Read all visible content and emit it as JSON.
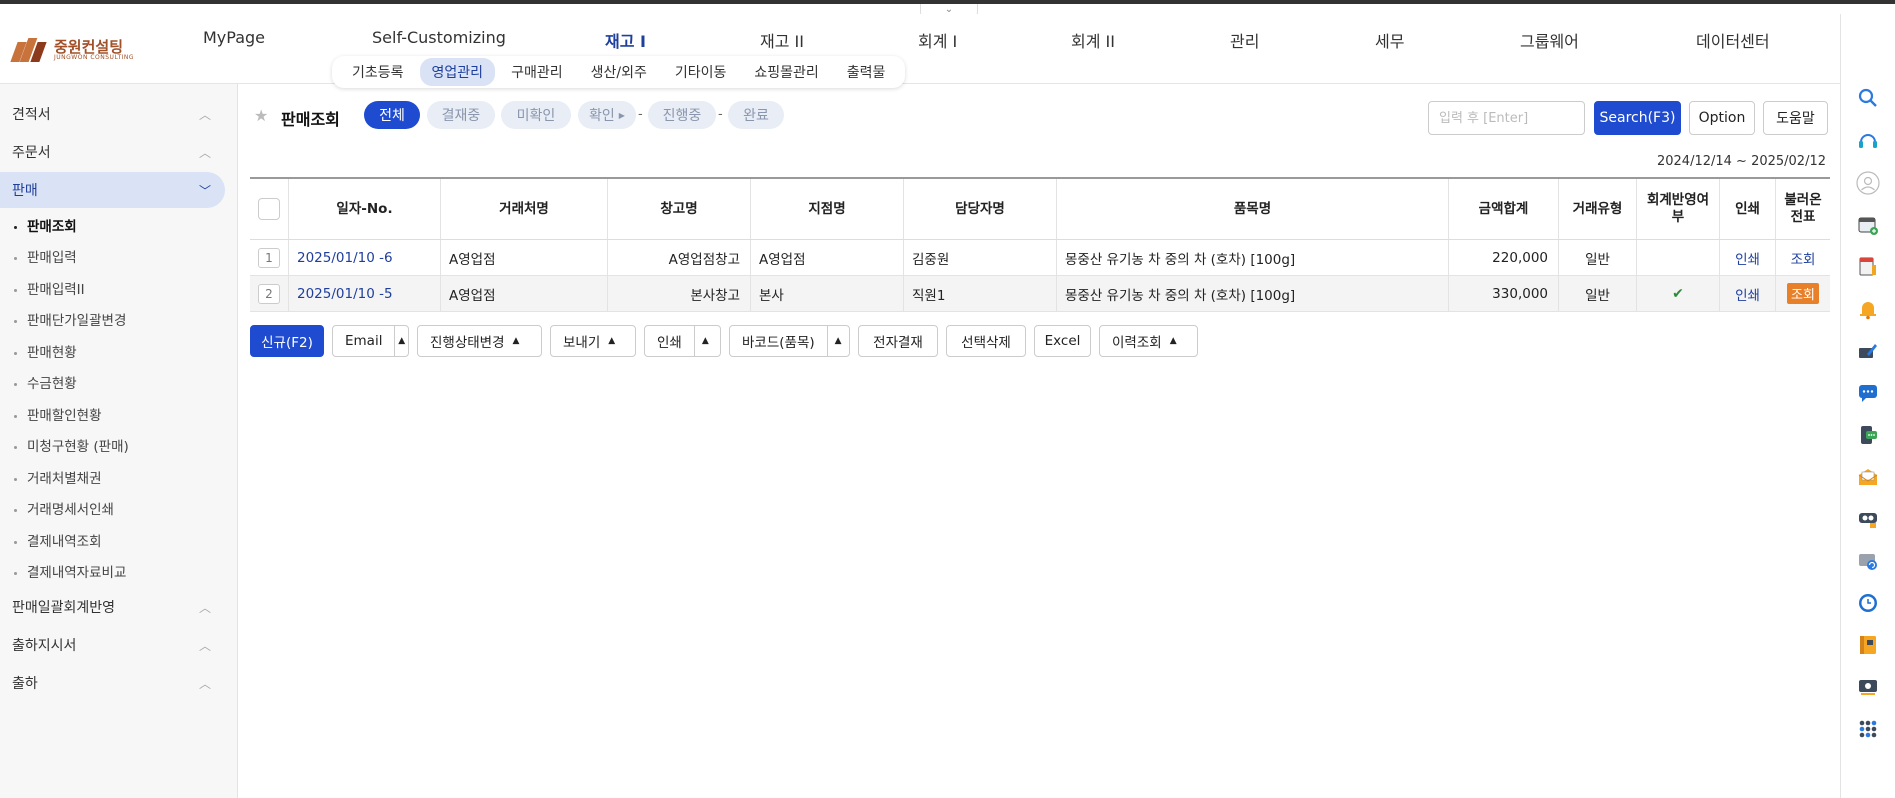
{
  "logo": {
    "ko": "중원컨설팅",
    "en": "JUNGWON CONSULTING"
  },
  "mainnav": [
    "MyPage",
    "Self-Customizing",
    "재고 I",
    "재고 II",
    "회계 I",
    "회계 II",
    "관리",
    "세무",
    "그룹웨어",
    "데이터센터"
  ],
  "mainnav_active": "재고 I",
  "subnav": [
    "기초등록",
    "영업관리",
    "구매관리",
    "생산/외주",
    "기타이동",
    "쇼핑몰관리",
    "출력물"
  ],
  "subnav_active": "영업관리",
  "sidebar": {
    "groups": [
      {
        "label": "견적서",
        "state": "collapsed"
      },
      {
        "label": "주문서",
        "state": "collapsed"
      },
      {
        "label": "판매",
        "state": "expanded"
      },
      {
        "label": "판매일괄회계반영",
        "state": "collapsed"
      },
      {
        "label": "출하지시서",
        "state": "collapsed"
      },
      {
        "label": "출하",
        "state": "collapsed"
      }
    ],
    "items": [
      "판매조회",
      "판매입력",
      "판매입력II",
      "판매단가일괄변경",
      "판매현황",
      "수금현황",
      "판매할인현황",
      "미청구현황 (판매)",
      "거래처별채권",
      "거래명세서인쇄",
      "결제내역조회",
      "결제내역자료비교"
    ],
    "active_item": "판매조회"
  },
  "page": {
    "title": "판매조회",
    "filters": [
      "전체",
      "결재중",
      "미확인",
      "확인",
      "진행중",
      "완료"
    ],
    "active_filter": "전체",
    "search_placeholder": "입력 후 [Enter]",
    "search_button": "Search(F3)",
    "option_button": "Option",
    "help_button": "도움말",
    "date_range": "2024/12/14 ~ 2025/02/12"
  },
  "table": {
    "headers": [
      "일자-No.",
      "거래처명",
      "창고명",
      "지점명",
      "담당자명",
      "품목명",
      "금액합계",
      "거래유형",
      "회계반영여부",
      "인쇄",
      "불러온전표"
    ],
    "rows": [
      {
        "num": "1",
        "date_no": "2025/01/10 -6",
        "customer": "A영업점",
        "warehouse": "A영업점창고",
        "branch": "A영업점",
        "manager": "김중원",
        "item": "몽중산 유기농 차 중의 차 (호차) [100g]",
        "amount": "220,000",
        "type": "일반",
        "acct": "",
        "print": "인쇄",
        "voucher": "조회",
        "voucher_highlight": false
      },
      {
        "num": "2",
        "date_no": "2025/01/10 -5",
        "customer": "A영업점",
        "warehouse": "본사창고",
        "branch": "본사",
        "manager": "직원1",
        "item": "몽중산 유기농 차 중의 차 (호차) [100g]",
        "amount": "330,000",
        "type": "일반",
        "acct": "✔",
        "print": "인쇄",
        "voucher": "조회",
        "voucher_highlight": true
      }
    ]
  },
  "toolbar": {
    "new": "신규(F2)",
    "email": "Email",
    "status_change": "진행상태변경",
    "send": "보내기",
    "print": "인쇄",
    "barcode": "바코드(품목)",
    "e_approval": "전자결재",
    "delete_selected": "선택삭제",
    "excel": "Excel",
    "history": "이력조회"
  },
  "colors": {
    "primary": "#1f4bd0",
    "nav_active": "#1f3f9d",
    "highlight": "#e8802a"
  },
  "rail_icons": [
    "search-icon",
    "headset-icon",
    "user-icon",
    "calendar-add-icon",
    "note-icon",
    "bell-icon",
    "edit-icon",
    "chat-icon",
    "phone-chat-icon",
    "mail-icon",
    "eye-icon",
    "refresh-icon",
    "clock-icon",
    "book-icon",
    "image-icon",
    "apps-icon"
  ]
}
